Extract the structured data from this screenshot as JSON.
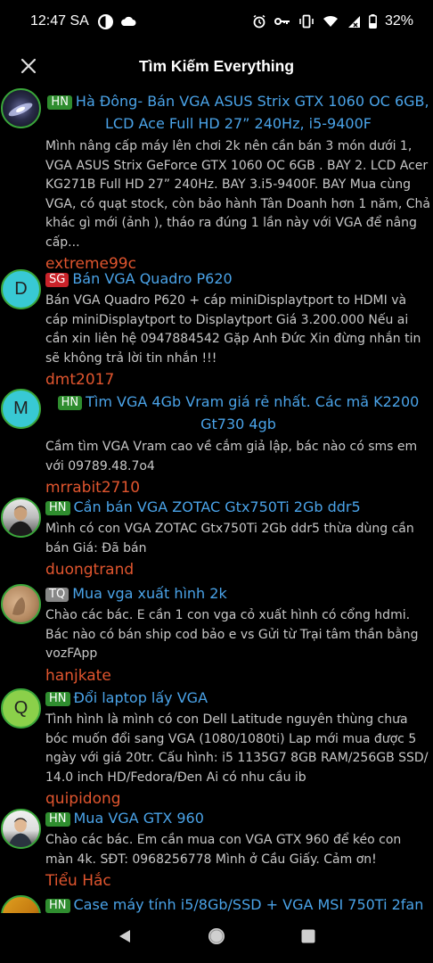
{
  "status": {
    "time": "12:47 SA",
    "battery": "32%"
  },
  "header": {
    "title": "Tìm Kiếm Everything"
  },
  "results": [
    {
      "badge": "HN",
      "title": "Hà Đông- Bán VGA ASUS Strix GTX 1060 OC 6GB, LCD Ace Full HD 27” 240Hz, i5-9400F",
      "excerpt": "Mình nâng cấp máy lên chơi 2k nên cần bán 3 món dưới 1, VGA ASUS Strix GeForce GTX 1060 OC 6GB . BAY 2. LCD Acer KG271B Full HD 27” 240Hz. BAY 3.i5-9400F. BAY Mua cùng VGA, có quạt stock, còn bảo hành Tân Doanh hơn 1 năm, Chả khác gì mới (ảnh ), tháo ra đúng 1 lần này với VGA để nâng cấp...",
      "author": "extreme99c",
      "avatar_letter": ""
    },
    {
      "badge": "SG",
      "title": "Bán VGA Quadro P620",
      "excerpt": "Bán VGA Quadro P620 + cáp miniDisplaytport to HDMI và cáp miniDisplaytport to Displaytport Giá 3.200.000 Nếu ai cần xin liên hệ 0947884542 Gặp Anh Đức Xin đừng nhắn tin sẽ không trả lời tin nhắn !!!",
      "author": "dmt2017",
      "avatar_letter": "D"
    },
    {
      "badge": "HN",
      "title": "Tìm VGA 4Gb Vram giá rẻ nhất. Các mã K2200 Gt730 4gb",
      "excerpt": "Cầm tìm VGA Vram cao về cắm giả lập, bác nào có sms em với 09789.48.7o4",
      "author": "mrrabit2710",
      "avatar_letter": "M"
    },
    {
      "badge": "HN",
      "title": "Cần bán VGA ZOTAC Gtx750Ti 2Gb ddr5",
      "excerpt": "Mình có con VGA ZOTAC Gtx750Ti 2Gb ddr5 thừa dùng cần bán Giá: Đã bán",
      "author": "duongtrand",
      "avatar_letter": ""
    },
    {
      "badge": "TQ",
      "title": "Mua vga xuất hình 2k",
      "excerpt": "Chào các bác. E cần 1 con vga cỏ xuất hình có cổng hdmi. Bác nào có bán ship cod bảo e vs Gửi từ Trại tâm thần bằng vozFApp",
      "author": "hanjkate",
      "avatar_letter": ""
    },
    {
      "badge": "HN",
      "title": "Đổi laptop lấy VGA",
      "excerpt": "Tình hình là mình có con Dell Latitude nguyên thùng chưa bóc muốn đổi sang VGA (1080/1080ti) Lap mới mua được 5 ngày với giá 20tr. Cấu hình: i5 1135G7 8GB RAM/256GB SSD/ 14.0 inch HD/Fedora/Đen Ai có nhu cầu ib",
      "author": "quipidong",
      "avatar_letter": "Q"
    },
    {
      "badge": "HN",
      "title": "Mua VGA GTX 960",
      "excerpt": "Chào các bác. Em cần mua con VGA GTX 960 để kéo con màn 4k. SĐT: 0968256778 Mình ở Cầu Giấy. Cảm ơn!",
      "author": "Tiểu Hắc",
      "avatar_letter": ""
    },
    {
      "badge": "HN",
      "title": "Case máy tính i5/8Gb/SSD + VGA MSI 750Ti 2fan",
      "excerpt": "",
      "author": "",
      "avatar_letter": ""
    }
  ],
  "colors": {
    "title_link": "#4aa3e8",
    "author": "#e0552e",
    "badge_hn": "#2f8d2f",
    "badge_sg": "#c9232a",
    "badge_tq": "#888888",
    "avatar_border": "#3aa63a"
  },
  "icons": {
    "close": "close-icon",
    "back": "nav-back-icon",
    "home": "nav-home-icon",
    "recents": "nav-recents-icon"
  }
}
